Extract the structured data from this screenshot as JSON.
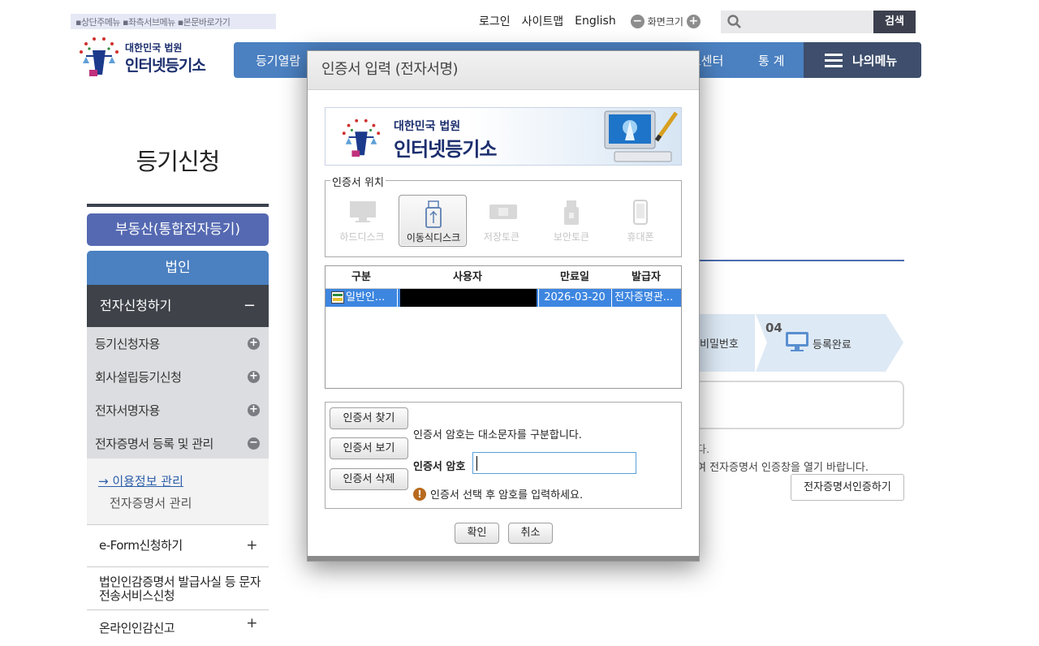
{
  "header": {
    "skip_links": "▪상단주메뉴 ▪좌측서브메뉴 ▪본문바로가기",
    "logo_line1": "대한민국 법원",
    "logo_line2": "인터넷등기소",
    "util_links": [
      "로그인",
      "사이트맵",
      "English"
    ],
    "zoom_label": "화면크기",
    "search_button": "검색",
    "search_placeholder": ""
  },
  "gnb": {
    "item1": "등기열람",
    "item2": "료센터",
    "item3": "통 계",
    "my_menu": "나의메뉴"
  },
  "sidebar": {
    "page_title": "등기신청",
    "top_button": "부동산(통합전자등기)",
    "section": "법인",
    "active_item": "전자신청하기",
    "active_sign": "−",
    "sub_items": [
      {
        "label": "등기신청자용"
      },
      {
        "label": "회사설립등기신청"
      },
      {
        "label": "전자서명자용"
      },
      {
        "label": "전자증명서 등록 및 관리"
      }
    ],
    "sub_sub_items": [
      "→ 이용정보 관리",
      "전자증명서 관리"
    ],
    "rows": [
      {
        "label": "e-Form신청하기",
        "sign": "+"
      },
      {
        "label": "법인인감증명서 발급사실 등 문자전송서비스신청",
        "sign": ""
      },
      {
        "label": "온라인인감신고",
        "sign": "+"
      }
    ]
  },
  "background": {
    "step3_text": "비밀번호",
    "step4_num": "04",
    "step4_text": "등록완료",
    "note1": "다.",
    "note2": "여 전자증명서 인증창을 열기 바랍니다.",
    "cert_button": "전자증명서인증하기"
  },
  "dialog": {
    "title": "인증서 입력 (전자서명)",
    "banner_line1": "대한민국 법원",
    "banner_line2": "인터넷등기소",
    "location_legend": "인증서 위치",
    "locations": [
      {
        "label": "하드디스크",
        "icon": "hard-disk-icon",
        "selected": false
      },
      {
        "label": "이동식디스크",
        "icon": "usb-drive-icon",
        "selected": true
      },
      {
        "label": "저장토큰",
        "icon": "storage-token-icon",
        "selected": false
      },
      {
        "label": "보안토큰",
        "icon": "security-token-icon",
        "selected": false
      },
      {
        "label": "휴대폰",
        "icon": "mobile-phone-icon",
        "selected": false
      }
    ],
    "table_headers": [
      "구분",
      "사용자",
      "만료일",
      "발급자"
    ],
    "cert_row": {
      "type": "일반인...",
      "user": "",
      "expiry": "2026-03-20",
      "issuer": "전자증명관..."
    },
    "buttons": {
      "find": "인증서 찾기",
      "view": "인증서 보기",
      "delete": "인증서 삭제",
      "ok": "확인",
      "cancel": "취소"
    },
    "case_note": "인증서 암호는 대소문자를 구분합니다.",
    "password_label": "인증서 암호",
    "password_value": "",
    "warning": "인증서 선택 후 암호를 입력하세요.",
    "colors": {
      "selection": "#3d86e0",
      "gnb": "#4b80c1",
      "warning": "#b86a1e"
    }
  }
}
